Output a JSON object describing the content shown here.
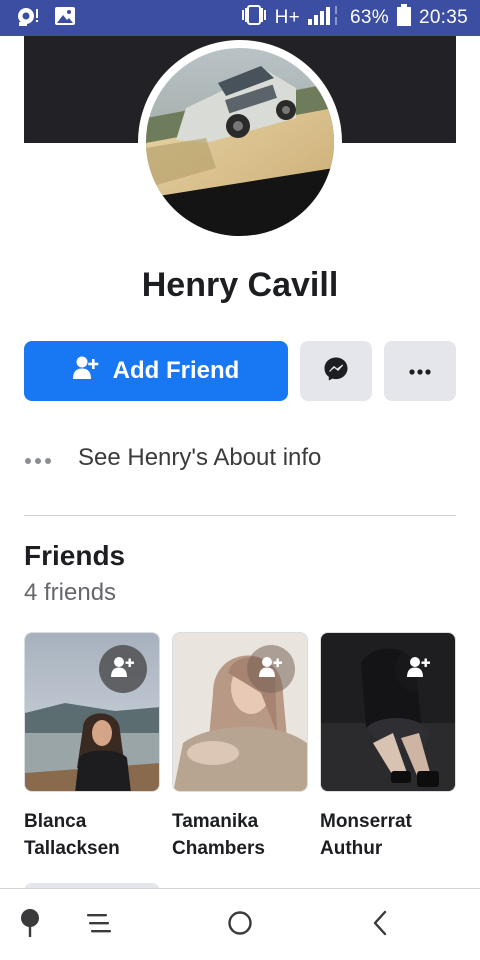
{
  "status_bar": {
    "network_label": "H+",
    "battery": "63%",
    "time": "20:35",
    "icons": [
      "notification-icon",
      "gallery-icon",
      "vibrate-icon",
      "signal-icon",
      "battery-icon"
    ]
  },
  "profile": {
    "name": "Henry Cavill"
  },
  "actions": {
    "add_friend_label": "Add Friend",
    "messenger_icon": "messenger-icon",
    "more_icon": "ellipsis-icon"
  },
  "about": {
    "label": "See Henry's About info"
  },
  "friends": {
    "title": "Friends",
    "count": "4 friends",
    "items": [
      {
        "name_line1": "Blanca",
        "name_line2": "Tallacksen"
      },
      {
        "name_line1": "Tamanika",
        "name_line2": "Chambers"
      },
      {
        "name_line1": "Monserrat",
        "name_line2": "Authur"
      }
    ]
  },
  "nav": {
    "icons": [
      "pin-icon",
      "menu-icon",
      "home-circle-icon",
      "back-icon"
    ]
  },
  "colors": {
    "status_bar": "#3b4ea1",
    "primary": "#1877f2",
    "button_gray": "#e4e6eb",
    "text_dark": "#1c1e21",
    "text_muted": "#65676b"
  }
}
